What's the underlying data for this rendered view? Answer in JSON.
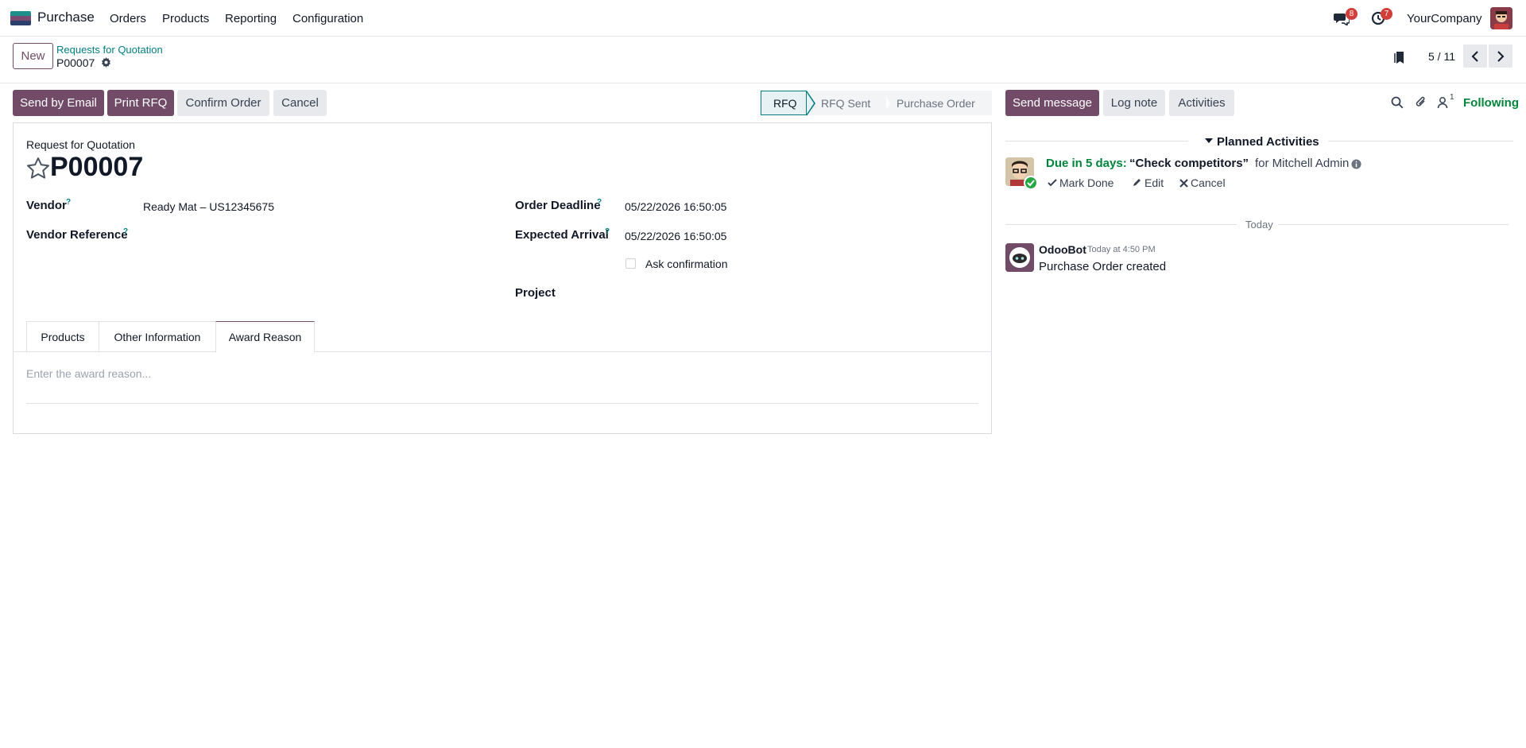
{
  "navbar": {
    "app_name": "Purchase",
    "menu": [
      "Orders",
      "Products",
      "Reporting",
      "Configuration"
    ],
    "messages_count": "8",
    "activities_count": "7",
    "company": "YourCompany"
  },
  "control_panel": {
    "new_label": "New",
    "breadcrumb_parent": "Requests for Quotation",
    "breadcrumb_current": "P00007",
    "pager": "5 / 11"
  },
  "actions": {
    "send_by_email": "Send by Email",
    "print_rfq": "Print RFQ",
    "confirm_order": "Confirm Order",
    "cancel": "Cancel"
  },
  "statusbar": {
    "stages": [
      "RFQ",
      "RFQ Sent",
      "Purchase Order"
    ],
    "current": "RFQ"
  },
  "form": {
    "doc_type": "Request for Quotation",
    "name": "P00007",
    "vendor_label": "Vendor",
    "vendor_value": "Ready Mat – US12345675",
    "vendor_ref_label": "Vendor Reference",
    "help_mark": "?",
    "order_deadline_label": "Order Deadline",
    "order_deadline_value": "05/22/2026 16:50:05",
    "expected_arrival_label": "Expected Arrival",
    "expected_arrival_value": "05/22/2026 16:50:05",
    "ask_confirmation_label": "Ask confirmation",
    "project_label": "Project",
    "tabs": [
      "Products",
      "Other Information",
      "Award Reason"
    ],
    "active_tab": "Award Reason",
    "award_placeholder": "Enter the award reason..."
  },
  "chatter": {
    "send_message": "Send message",
    "log_note": "Log note",
    "activities": "Activities",
    "followers_count": "1",
    "following": "Following",
    "planned_activities": "Planned Activities",
    "activity": {
      "due": "Due in 5 days:",
      "summary": "“Check competitors”",
      "assignee": "for Mitchell Admin",
      "mark_done": "Mark Done",
      "edit": "Edit",
      "cancel": "Cancel"
    },
    "date_separator": "Today",
    "message": {
      "author": "OdooBot",
      "time": "Today at 4:50 PM",
      "body": "Purchase Order created"
    }
  },
  "colors": {
    "primary": "#714b67",
    "link": "#017e84",
    "success": "#00853b",
    "badge": "#d23f3a"
  }
}
